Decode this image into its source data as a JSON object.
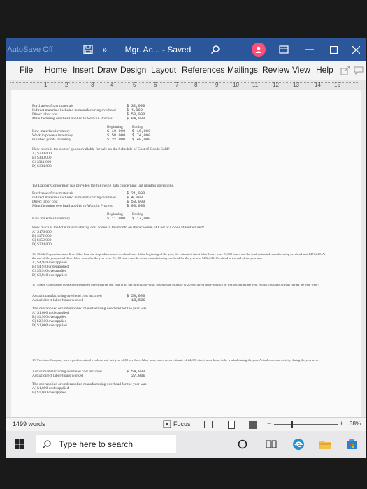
{
  "titlebar": {
    "autosave_label": "AutoSave",
    "autosave_state": "Off",
    "overflow": "»",
    "doc_title": "Mgr. Ac... - Saved",
    "accent": "#2b579a"
  },
  "ribbon_tabs": [
    "File",
    "Home",
    "Insert",
    "Draw",
    "Design",
    "Layout",
    "References",
    "Mailings",
    "Review",
    "View",
    "Help"
  ],
  "ruler_marks": [
    "1",
    "2",
    "3",
    "4",
    "5",
    "6",
    "7",
    "8",
    "9",
    "10",
    "11",
    "12",
    "13",
    "14",
    "15"
  ],
  "doc": {
    "p1_a": "Purchases of raw materials",
    "p1_b": "Indirect materials included in manufacturing overhead",
    "p1_c": "Direct labor cost",
    "p1_d": "Manufacturing overhead applied to Work in Process",
    "p1_va": "$ 32,000",
    "p1_vb": "$ 4,000",
    "p1_vc": "$ 58,000",
    "p1_vd": "$ 84,000",
    "p1_h1": "Beginning",
    "p1_h2": "Ending",
    "p1_e": "Raw materials inventory",
    "p1_f": "Work in process inventory",
    "p1_g": "Finished goods inventory",
    "p1_e1": "$ 10,000",
    "p1_e2": "$ 16,000",
    "p1_f1": "$ 58,000",
    "p1_f2": "$ 74,000",
    "p1_g1": "$ 32,000",
    "p1_g2": "$ 40,000",
    "p1_q": "How much is the cost of goods available for sale on the Schedule of Cost of Goods Sold?",
    "p1_opts": [
      "A) $330,000",
      "B) $340,000",
      "C) $311,000",
      "D) $334,000"
    ],
    "p2_q": "15) Dapper Corporation has provided the following data concerning last month's operations.",
    "p2_a": "Purchases of raw materials",
    "p2_b": "Indirect materials included in manufacturing overhead",
    "p2_c": "Direct labor cost",
    "p2_d": "Manufacturing overhead applied to Work in Process",
    "p2_va": "$ 21,000",
    "p2_vb": "$ 4,000",
    "p2_vc": "$ 58,000",
    "p2_vd": "$ 98,000",
    "p2_h1": "Beginning",
    "p2_h2": "Ending",
    "p2_e": "Raw materials inventory",
    "p2_e1": "$ 11,000",
    "p2_e2": "$ 17,000",
    "p2_q2": "How much is the total manufacturing cost added to the month on the Schedule of Cost of Goods Manufactured?",
    "p2_opts": [
      "A) $176,000",
      "B) $172,000",
      "C) $152,000",
      "D) $224,000"
    ],
    "p3_q": "16) Chick Corporation uses direct labor-hours in its predetermined overhead rate. At the beginning of the year, the estimated direct labor-hours were 21,000 hours and the total estimated manufacturing overhead was $497,240. At",
    "p3_q2": "the end of the year, actual direct labor-hours for the year were 21,100 hours and the actual manufacturing overhead for the year was $492,240. Overhead at the end of the year was:",
    "p3_opts": [
      "A) $4,940 overapplied",
      "B) $4,940 underapplied",
      "C) $3,940 overapplied",
      "D) $3,940 overapplied"
    ],
    "p4_q": "17) Daken Corporation used a predetermined overhead rate last year of $3 per direct labor-hour, based on an estimate of 20,000 direct labor-hours to be worked during the year. Actual costs and activity during the year were:",
    "p4_a": "Actual manufacturing overhead cost incurred",
    "p4_b": "Actual direct labor-hours worked",
    "p4_va": "$ 58,000",
    "p4_vb": "18,500",
    "p4_c": "The overapplied or underapplied manufacturing overhead for the year was:",
    "p4_opts": [
      "A) $1,000 underapplied",
      "B) $1,500 overapplied",
      "C) $2,500 overapplied",
      "D) $1,000 overapplied"
    ],
    "p5_q": "18) Precision Company used a predetermined overhead rate last year of $2 per direct labor-hour, based on an estimate of 24,000 direct labor-hours to be worked during the year. Actual costs and activity during the year were:",
    "p5_a": "Actual manufacturing overhead cost incurred",
    "p5_b": "Actual direct labor-hours worked",
    "p5_va": "$ 54,000",
    "p5_vb": "27,000",
    "p5_c": "The overapplied or underapplied manufacturing overhead for the year was:",
    "p5_opts": [
      "A) $1,000 underapplied",
      "B) $1,000 overapplied"
    ]
  },
  "status": {
    "words": "1499 words",
    "focus": "Focus",
    "minus": "−",
    "plus": "+",
    "zoom": "38%"
  },
  "taskbar": {
    "search_placeholder": "Type here to search"
  }
}
